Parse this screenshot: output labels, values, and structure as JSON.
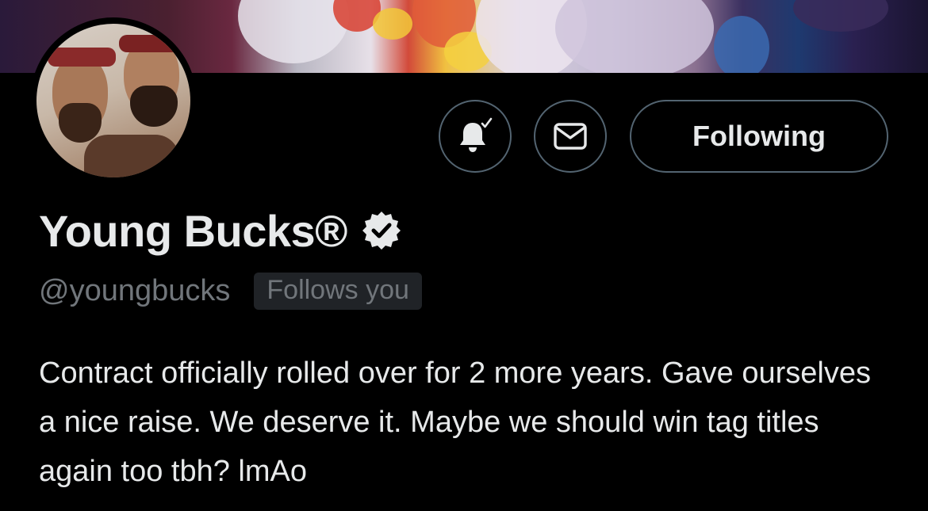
{
  "profile": {
    "display_name": "Young Bucks®",
    "handle": "@youngbucks",
    "follows_you_badge": "Follows you",
    "bio": "Contract officially rolled over for 2 more years. Gave ourselves a nice raise. We deserve it. Maybe we should win tag titles again too tbh? lmAo",
    "verified": true
  },
  "actions": {
    "notifications_icon": "bell-check-icon",
    "message_icon": "envelope-icon",
    "follow_label": "Following"
  },
  "colors": {
    "background": "#000000",
    "text_primary": "#e7e9ea",
    "text_secondary": "#71767b",
    "button_border": "#536471",
    "badge_background": "#202327"
  }
}
